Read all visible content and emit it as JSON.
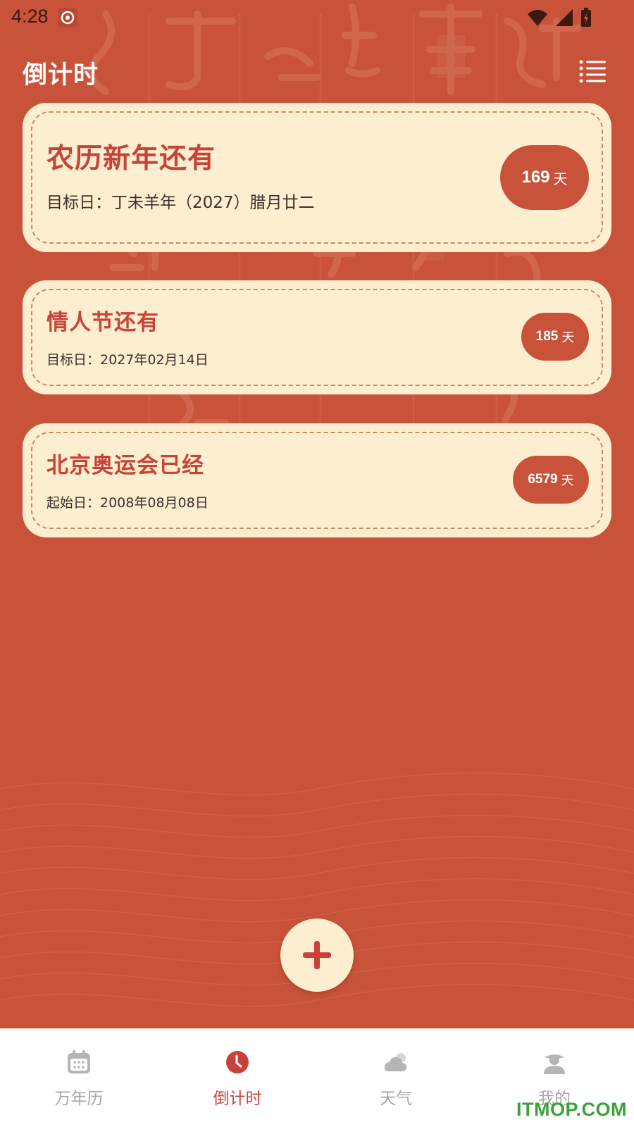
{
  "status_bar": {
    "time": "4:28"
  },
  "header": {
    "title": "倒计时",
    "menu_icon": "list-icon"
  },
  "countdowns": [
    {
      "title": "农历新年还有",
      "date_label": "目标日：丁未羊年（2027）腊月廿二",
      "days": "169",
      "unit": "天"
    },
    {
      "title": "情人节还有",
      "date_label": "目标日：2027年02月14日",
      "days": "185",
      "unit": "天"
    },
    {
      "title": "北京奥运会已经",
      "date_label": "起始日：2008年08月08日",
      "days": "6579",
      "unit": "天"
    }
  ],
  "fab": {
    "icon": "plus-icon"
  },
  "bottom_nav": {
    "items": [
      {
        "label": "万年历",
        "icon": "calendar-icon",
        "active": false
      },
      {
        "label": "倒计时",
        "icon": "clock-icon",
        "active": true
      },
      {
        "label": "天气",
        "icon": "cloud-icon",
        "active": false
      },
      {
        "label": "我的",
        "icon": "user-icon",
        "active": false
      }
    ]
  },
  "watermark": "ITMOP.COM",
  "colors": {
    "background": "#C8533A",
    "card": "#FDEECF",
    "title_red": "#C9423A",
    "nav_inactive": "#A7A7A7"
  }
}
